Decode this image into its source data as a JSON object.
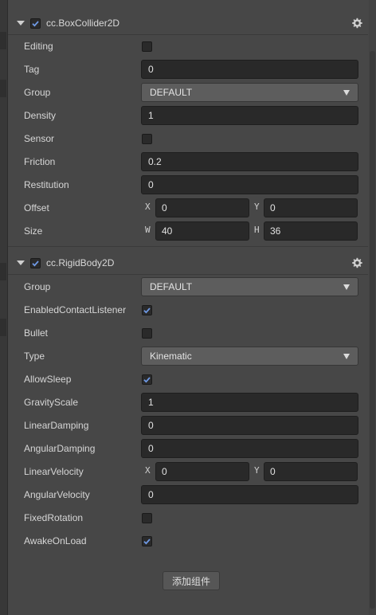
{
  "box_collider": {
    "title": "cc.BoxCollider2D",
    "enabled": true,
    "props": {
      "editing": {
        "label": "Editing",
        "checked": false
      },
      "tag": {
        "label": "Tag",
        "value": "0"
      },
      "group": {
        "label": "Group",
        "value": "DEFAULT"
      },
      "density": {
        "label": "Density",
        "value": "1"
      },
      "sensor": {
        "label": "Sensor",
        "checked": false
      },
      "friction": {
        "label": "Friction",
        "value": "0.2"
      },
      "restitution": {
        "label": "Restitution",
        "value": "0"
      },
      "offset": {
        "label": "Offset",
        "x_label": "X",
        "x": "0",
        "y_label": "Y",
        "y": "0"
      },
      "size": {
        "label": "Size",
        "w_label": "W",
        "w": "40",
        "h_label": "H",
        "h": "36"
      }
    }
  },
  "rigid_body": {
    "title": "cc.RigidBody2D",
    "enabled": true,
    "props": {
      "group": {
        "label": "Group",
        "value": "DEFAULT"
      },
      "enabled_contact_listener": {
        "label": "EnabledContactListener",
        "checked": true
      },
      "bullet": {
        "label": "Bullet",
        "checked": false
      },
      "type": {
        "label": "Type",
        "value": "Kinematic"
      },
      "allow_sleep": {
        "label": "AllowSleep",
        "checked": true
      },
      "gravity_scale": {
        "label": "GravityScale",
        "value": "1"
      },
      "linear_damping": {
        "label": "LinearDamping",
        "value": "0"
      },
      "angular_damping": {
        "label": "AngularDamping",
        "value": "0"
      },
      "linear_velocity": {
        "label": "LinearVelocity",
        "x_label": "X",
        "x": "0",
        "y_label": "Y",
        "y": "0"
      },
      "angular_velocity": {
        "label": "AngularVelocity",
        "value": "0"
      },
      "fixed_rotation": {
        "label": "FixedRotation",
        "checked": false
      },
      "awake_on_load": {
        "label": "AwakeOnLoad",
        "checked": true
      }
    }
  },
  "add_component_label": "添加组件",
  "icons": {
    "collapse": "caret-down-icon",
    "settings": "gear-icon",
    "check": "checkmark-icon"
  },
  "colors": {
    "checkbox_tick": "#6f9ae6",
    "panel_bg": "#474747",
    "field_bg": "#292929"
  }
}
